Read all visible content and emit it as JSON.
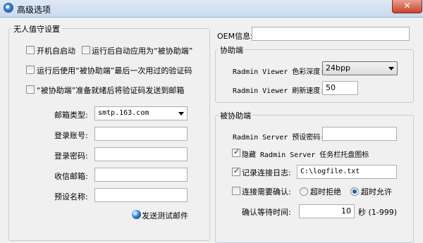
{
  "window": {
    "title": "高级选项",
    "close_symbol": "✕"
  },
  "unattended": {
    "title": "无人值守设置",
    "autostart_label": "开机自启动",
    "autorun_as_assisted_label": "运行后自动应用为“被协助端”",
    "use_last_code_label": "运行后使用“被协助端”最后一次用过的验证码",
    "send_code_email_label": "“被协助端”准备就绪后将验证码发送到邮箱",
    "mail_type_label": "邮箱类型:",
    "mail_type_value": "smtp.163.com",
    "login_account_label": "登录账号:",
    "login_account_value": "",
    "login_password_label": "登录密码:",
    "login_password_value": "",
    "recipient_label": "收信邮箱:",
    "recipient_value": "",
    "preset_name_label": "预设名称:",
    "preset_name_value": "",
    "send_test_label": "发送测试邮件"
  },
  "oem": {
    "label": "OEM信息:",
    "value": ""
  },
  "assistant": {
    "title": "协助端",
    "color_depth_label": "Radmin Viewer 色彩深度:",
    "color_depth_value": "24bpp",
    "refresh_rate_label": "Radmin Viewer 刷新速度:",
    "refresh_rate_value": "50"
  },
  "assisted": {
    "title": "被协助端",
    "preset_password_label": "Radmin Server 预设密码:",
    "preset_password_value": "",
    "hide_tray_label": "隐藏 Radmin Server 任务栏托盘图标",
    "log_label": "记录连接日志:",
    "log_path": "C:\\logfile.txt",
    "confirm_label": "连接需要确认:",
    "timeout_reject_label": "超时拒绝",
    "timeout_allow_label": "超时允许",
    "wait_time_label": "确认等待时间:",
    "wait_time_value": "10",
    "wait_time_unit": "秒 (1-999)"
  }
}
